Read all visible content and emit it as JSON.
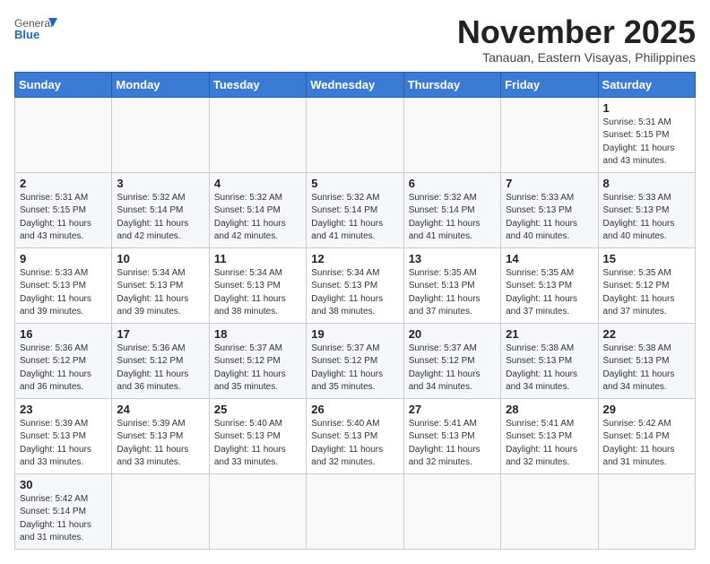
{
  "header": {
    "logo_general": "General",
    "logo_blue": "Blue",
    "month_year": "November 2025",
    "location": "Tanauan, Eastern Visayas, Philippines"
  },
  "days_of_week": [
    "Sunday",
    "Monday",
    "Tuesday",
    "Wednesday",
    "Thursday",
    "Friday",
    "Saturday"
  ],
  "weeks": [
    [
      {
        "day": "",
        "sunrise": "",
        "sunset": "",
        "daylight": ""
      },
      {
        "day": "",
        "sunrise": "",
        "sunset": "",
        "daylight": ""
      },
      {
        "day": "",
        "sunrise": "",
        "sunset": "",
        "daylight": ""
      },
      {
        "day": "",
        "sunrise": "",
        "sunset": "",
        "daylight": ""
      },
      {
        "day": "",
        "sunrise": "",
        "sunset": "",
        "daylight": ""
      },
      {
        "day": "",
        "sunrise": "",
        "sunset": "",
        "daylight": ""
      },
      {
        "day": "1",
        "sunrise": "Sunrise: 5:31 AM",
        "sunset": "Sunset: 5:15 PM",
        "daylight": "Daylight: 11 hours and 43 minutes."
      }
    ],
    [
      {
        "day": "2",
        "sunrise": "Sunrise: 5:31 AM",
        "sunset": "Sunset: 5:15 PM",
        "daylight": "Daylight: 11 hours and 43 minutes."
      },
      {
        "day": "3",
        "sunrise": "Sunrise: 5:32 AM",
        "sunset": "Sunset: 5:14 PM",
        "daylight": "Daylight: 11 hours and 42 minutes."
      },
      {
        "day": "4",
        "sunrise": "Sunrise: 5:32 AM",
        "sunset": "Sunset: 5:14 PM",
        "daylight": "Daylight: 11 hours and 42 minutes."
      },
      {
        "day": "5",
        "sunrise": "Sunrise: 5:32 AM",
        "sunset": "Sunset: 5:14 PM",
        "daylight": "Daylight: 11 hours and 41 minutes."
      },
      {
        "day": "6",
        "sunrise": "Sunrise: 5:32 AM",
        "sunset": "Sunset: 5:14 PM",
        "daylight": "Daylight: 11 hours and 41 minutes."
      },
      {
        "day": "7",
        "sunrise": "Sunrise: 5:33 AM",
        "sunset": "Sunset: 5:13 PM",
        "daylight": "Daylight: 11 hours and 40 minutes."
      },
      {
        "day": "8",
        "sunrise": "Sunrise: 5:33 AM",
        "sunset": "Sunset: 5:13 PM",
        "daylight": "Daylight: 11 hours and 40 minutes."
      }
    ],
    [
      {
        "day": "9",
        "sunrise": "Sunrise: 5:33 AM",
        "sunset": "Sunset: 5:13 PM",
        "daylight": "Daylight: 11 hours and 39 minutes."
      },
      {
        "day": "10",
        "sunrise": "Sunrise: 5:34 AM",
        "sunset": "Sunset: 5:13 PM",
        "daylight": "Daylight: 11 hours and 39 minutes."
      },
      {
        "day": "11",
        "sunrise": "Sunrise: 5:34 AM",
        "sunset": "Sunset: 5:13 PM",
        "daylight": "Daylight: 11 hours and 38 minutes."
      },
      {
        "day": "12",
        "sunrise": "Sunrise: 5:34 AM",
        "sunset": "Sunset: 5:13 PM",
        "daylight": "Daylight: 11 hours and 38 minutes."
      },
      {
        "day": "13",
        "sunrise": "Sunrise: 5:35 AM",
        "sunset": "Sunset: 5:13 PM",
        "daylight": "Daylight: 11 hours and 37 minutes."
      },
      {
        "day": "14",
        "sunrise": "Sunrise: 5:35 AM",
        "sunset": "Sunset: 5:13 PM",
        "daylight": "Daylight: 11 hours and 37 minutes."
      },
      {
        "day": "15",
        "sunrise": "Sunrise: 5:35 AM",
        "sunset": "Sunset: 5:12 PM",
        "daylight": "Daylight: 11 hours and 37 minutes."
      }
    ],
    [
      {
        "day": "16",
        "sunrise": "Sunrise: 5:36 AM",
        "sunset": "Sunset: 5:12 PM",
        "daylight": "Daylight: 11 hours and 36 minutes."
      },
      {
        "day": "17",
        "sunrise": "Sunrise: 5:36 AM",
        "sunset": "Sunset: 5:12 PM",
        "daylight": "Daylight: 11 hours and 36 minutes."
      },
      {
        "day": "18",
        "sunrise": "Sunrise: 5:37 AM",
        "sunset": "Sunset: 5:12 PM",
        "daylight": "Daylight: 11 hours and 35 minutes."
      },
      {
        "day": "19",
        "sunrise": "Sunrise: 5:37 AM",
        "sunset": "Sunset: 5:12 PM",
        "daylight": "Daylight: 11 hours and 35 minutes."
      },
      {
        "day": "20",
        "sunrise": "Sunrise: 5:37 AM",
        "sunset": "Sunset: 5:12 PM",
        "daylight": "Daylight: 11 hours and 34 minutes."
      },
      {
        "day": "21",
        "sunrise": "Sunrise: 5:38 AM",
        "sunset": "Sunset: 5:13 PM",
        "daylight": "Daylight: 11 hours and 34 minutes."
      },
      {
        "day": "22",
        "sunrise": "Sunrise: 5:38 AM",
        "sunset": "Sunset: 5:13 PM",
        "daylight": "Daylight: 11 hours and 34 minutes."
      }
    ],
    [
      {
        "day": "23",
        "sunrise": "Sunrise: 5:39 AM",
        "sunset": "Sunset: 5:13 PM",
        "daylight": "Daylight: 11 hours and 33 minutes."
      },
      {
        "day": "24",
        "sunrise": "Sunrise: 5:39 AM",
        "sunset": "Sunset: 5:13 PM",
        "daylight": "Daylight: 11 hours and 33 minutes."
      },
      {
        "day": "25",
        "sunrise": "Sunrise: 5:40 AM",
        "sunset": "Sunset: 5:13 PM",
        "daylight": "Daylight: 11 hours and 33 minutes."
      },
      {
        "day": "26",
        "sunrise": "Sunrise: 5:40 AM",
        "sunset": "Sunset: 5:13 PM",
        "daylight": "Daylight: 11 hours and 32 minutes."
      },
      {
        "day": "27",
        "sunrise": "Sunrise: 5:41 AM",
        "sunset": "Sunset: 5:13 PM",
        "daylight": "Daylight: 11 hours and 32 minutes."
      },
      {
        "day": "28",
        "sunrise": "Sunrise: 5:41 AM",
        "sunset": "Sunset: 5:13 PM",
        "daylight": "Daylight: 11 hours and 32 minutes."
      },
      {
        "day": "29",
        "sunrise": "Sunrise: 5:42 AM",
        "sunset": "Sunset: 5:14 PM",
        "daylight": "Daylight: 11 hours and 31 minutes."
      }
    ],
    [
      {
        "day": "30",
        "sunrise": "Sunrise: 5:42 AM",
        "sunset": "Sunset: 5:14 PM",
        "daylight": "Daylight: 11 hours and 31 minutes."
      },
      {
        "day": "",
        "sunrise": "",
        "sunset": "",
        "daylight": ""
      },
      {
        "day": "",
        "sunrise": "",
        "sunset": "",
        "daylight": ""
      },
      {
        "day": "",
        "sunrise": "",
        "sunset": "",
        "daylight": ""
      },
      {
        "day": "",
        "sunrise": "",
        "sunset": "",
        "daylight": ""
      },
      {
        "day": "",
        "sunrise": "",
        "sunset": "",
        "daylight": ""
      },
      {
        "day": "",
        "sunrise": "",
        "sunset": "",
        "daylight": ""
      }
    ]
  ]
}
